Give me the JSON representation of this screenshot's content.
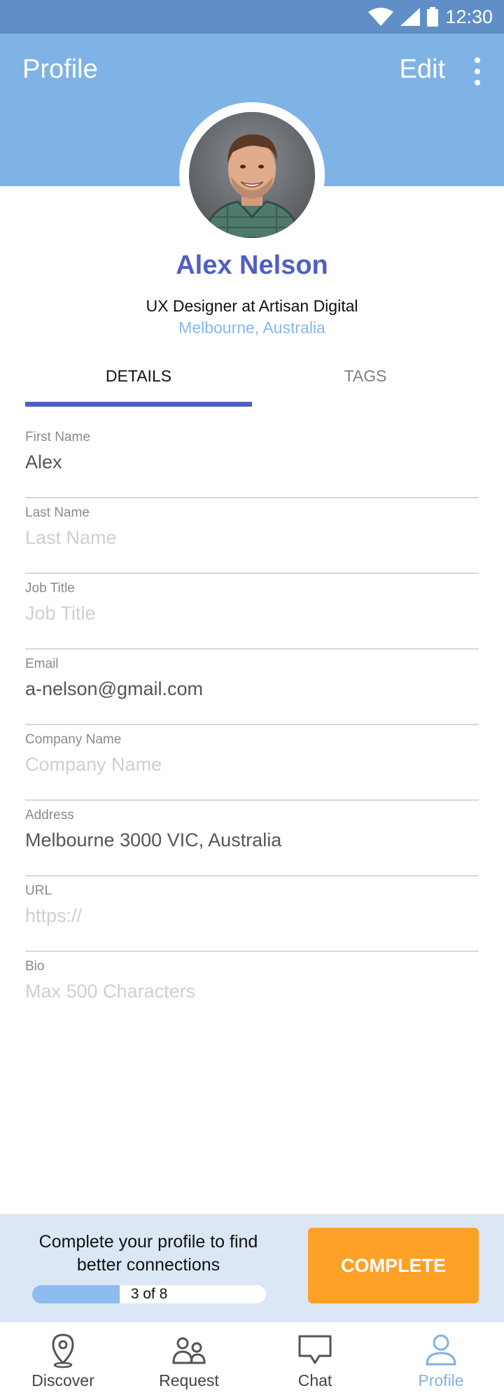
{
  "status_bar": {
    "time": "12:30"
  },
  "header": {
    "title": "Profile",
    "edit_label": "Edit"
  },
  "profile": {
    "name": "Alex Nelson",
    "job": "UX Designer at Artisan Digital",
    "location": "Melbourne, Australia"
  },
  "tabs": [
    {
      "label": "DETAILS",
      "active": true
    },
    {
      "label": "TAGS",
      "active": false
    }
  ],
  "fields": [
    {
      "label": "First Name",
      "value": "Alex",
      "placeholder": ""
    },
    {
      "label": "Last Name",
      "value": "",
      "placeholder": "Last Name"
    },
    {
      "label": "Job Title",
      "value": "",
      "placeholder": "Job Title"
    },
    {
      "label": "Email",
      "value": "a-nelson@gmail.com",
      "placeholder": ""
    },
    {
      "label": "Company Name",
      "value": "",
      "placeholder": "Company Name"
    },
    {
      "label": "Address",
      "value": "Melbourne 3000 VIC, Australia",
      "placeholder": ""
    },
    {
      "label": "URL",
      "value": "",
      "placeholder": "https://"
    },
    {
      "label": "Bio",
      "value": "",
      "placeholder": "Max 500 Characters"
    }
  ],
  "completion": {
    "message": "Complete your profile to find better connections",
    "progress_text": "3 of 8",
    "completed": 3,
    "total": 8,
    "button_label": "COMPLETE"
  },
  "nav": [
    {
      "label": "Discover",
      "icon": "location-pin-icon",
      "active": false
    },
    {
      "label": "Request",
      "icon": "people-icon",
      "active": false
    },
    {
      "label": "Chat",
      "icon": "chat-bubble-icon",
      "active": false
    },
    {
      "label": "Profile",
      "icon": "person-icon",
      "active": true
    }
  ],
  "colors": {
    "status_bar": "#5f8fc6",
    "app_bar": "#7fb3e6",
    "accent": "#5060c0",
    "complete_button": "#fca126",
    "banner": "#dbe7f4"
  }
}
